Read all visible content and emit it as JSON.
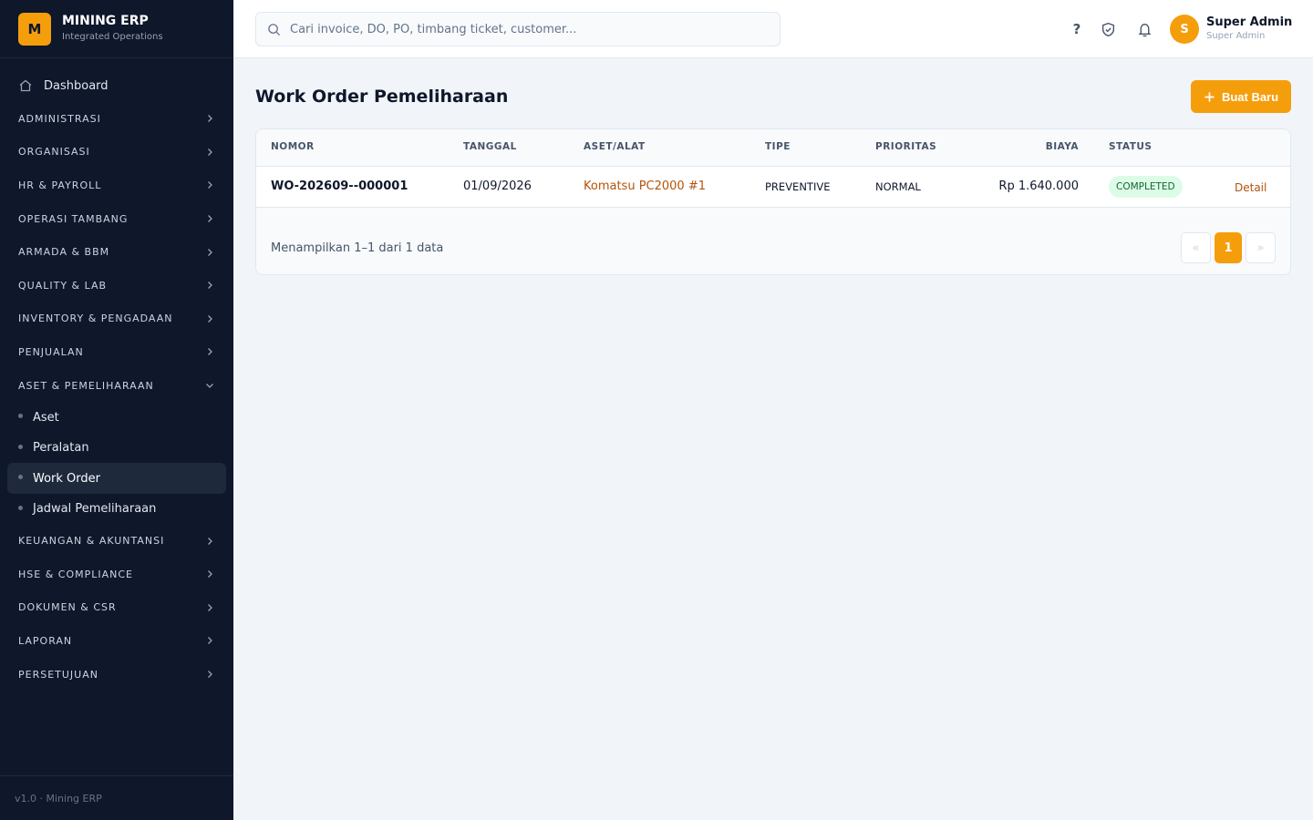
{
  "brand": {
    "logo_letter": "M",
    "name": "MINING ERP",
    "subtitle": "Integrated Operations"
  },
  "sidebar": {
    "dashboard": "Dashboard",
    "groups_top": [
      "ADMINISTRASI",
      "ORGANISASI",
      "HR & PAYROLL",
      "OPERASI TAMBANG",
      "ARMADA & BBM",
      "QUALITY & LAB",
      "INVENTORY & PENGADAAN",
      "PENJUALAN"
    ],
    "expanded_group": "ASET & PEMELIHARAAN",
    "sub_items": [
      "Aset",
      "Peralatan",
      "Work Order",
      "Jadwal Pemeliharaan"
    ],
    "active_sub_item": "Work Order",
    "groups_bottom": [
      "KEUANGAN & AKUNTANSI",
      "HSE & COMPLIANCE",
      "DOKUMEN & CSR",
      "LAPORAN",
      "PERSETUJUAN"
    ],
    "footer": "v1.0 · Mining ERP"
  },
  "header": {
    "search_placeholder": "Cari invoice, DO, PO, timbang ticket, customer...",
    "help_label": "?",
    "avatar_letter": "S",
    "user_name": "Super Admin",
    "user_role": "Super Admin"
  },
  "page": {
    "title": "Work Order Pemeliharaan",
    "new_button": "Buat Baru"
  },
  "table": {
    "columns": [
      "NOMOR",
      "TANGGAL",
      "ASET/ALAT",
      "TIPE",
      "PRIORITAS",
      "BIAYA",
      "STATUS"
    ],
    "rows": [
      {
        "nomor": "WO-202609--000001",
        "tanggal": "01/09/2026",
        "aset": "Komatsu PC2000 #1",
        "tipe": "PREVENTIVE",
        "prioritas": "NORMAL",
        "biaya": "Rp 1.640.000",
        "status": "COMPLETED",
        "action": "Detail"
      }
    ],
    "summary": "Menampilkan 1–1 dari 1 data",
    "pagination": {
      "prev": "«",
      "current": "1",
      "next": "»"
    }
  },
  "colors": {
    "accent": "#f59e0b",
    "sidebar_bg": "#0f172a",
    "link": "#b45309",
    "status_completed_bg": "#dcfce7"
  }
}
